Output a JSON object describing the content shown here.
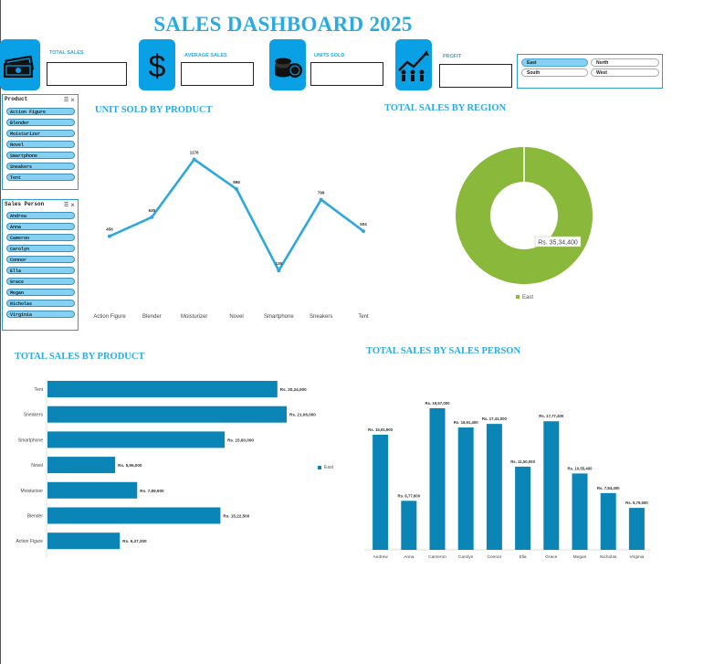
{
  "title": "SALES DASHBOARD 2025",
  "kpis": [
    {
      "label": "TOTAL SALES",
      "value": "",
      "icon": "money-icon"
    },
    {
      "label": "AVERAGE SALES",
      "value": "",
      "icon": "dollar-icon"
    },
    {
      "label": "UNITS SOLD",
      "value": "",
      "icon": "coins-icon"
    },
    {
      "label": "PROFIT",
      "value": "",
      "icon": "growth-people-icon"
    }
  ],
  "region_slicer": {
    "items": [
      {
        "label": "East",
        "selected": true
      },
      {
        "label": "North",
        "selected": false
      },
      {
        "label": "South",
        "selected": false
      },
      {
        "label": "West",
        "selected": false
      }
    ]
  },
  "product_slicer": {
    "title": "Product",
    "items": [
      "Action Figure",
      "Blender",
      "Moisturizer",
      "Novel",
      "Smartphone",
      "Sneakers",
      "Tent"
    ]
  },
  "person_slicer": {
    "title": "Sales Person",
    "items": [
      "Andrew",
      "Anna",
      "Cameron",
      "Carolyn",
      "Connor",
      "Ella",
      "Grace",
      "Megan",
      "Nicholas",
      "Virginia"
    ]
  },
  "colors": {
    "accent": "#29abe2",
    "bar": "#0a85b5",
    "line": "#2ea8dc",
    "donut": "#8ab83a"
  },
  "chart_data": [
    {
      "type": "line",
      "title": "UNIT SOLD BY PRODUCT",
      "categories": [
        "Action Figure",
        "Blender",
        "Moisturizer",
        "Novel",
        "Smartphone",
        "Sneakers",
        "Tent"
      ],
      "values": [
        456,
        635,
        1176,
        898,
        135,
        799,
        504
      ],
      "ylim": [
        0,
        1300
      ]
    },
    {
      "type": "pie",
      "title": "TOTAL SALES BY REGION",
      "labels": [
        "East"
      ],
      "values": [
        3534400
      ],
      "data_labels": [
        "Rs. 35,34,400"
      ],
      "legend": "bottom"
    },
    {
      "type": "bar",
      "orientation": "horizontal",
      "title": "TOTAL SALES BY PRODUCT",
      "categories": [
        "Tent",
        "Sneakers",
        "Smartphone",
        "Novel",
        "Moisturizer",
        "Blender",
        "Action Figure"
      ],
      "values": [
        2024000,
        2106000,
        1560000,
        596000,
        789900,
        1522500,
        637300
      ],
      "data_labels": [
        "Rs. 20,24,000",
        "Rs. 21,06,000",
        "Rs. 15,60,000",
        "Rs. 5,96,000",
        "Rs. 7,89,900",
        "Rs. 15,22,500",
        "Rs. 6,37,300"
      ],
      "legend": [
        "East"
      ],
      "legend_position": "right"
    },
    {
      "type": "bar",
      "title": "TOTAL SALES BY SALES PERSON",
      "categories": [
        "Andrew",
        "Anna",
        "Cameron",
        "Carolyn",
        "Connor",
        "Ella",
        "Grace",
        "Megan",
        "Nicholas",
        "Virginia"
      ],
      "values": [
        1591900,
        677600,
        1957000,
        1691400,
        1741000,
        1150000,
        1777400,
        1055400,
        784400,
        579500
      ],
      "data_labels": [
        "Rs. 15,91,900",
        "Rs. 6,77,600",
        "Rs. 19,57,000",
        "Rs. 16,91,400",
        "Rs. 17,41,000",
        "Rs. 11,50,000",
        "Rs. 17,77,400",
        "Rs. 10,55,400",
        "Rs. 7,84,400",
        "Rs. 5,79,500"
      ]
    }
  ]
}
